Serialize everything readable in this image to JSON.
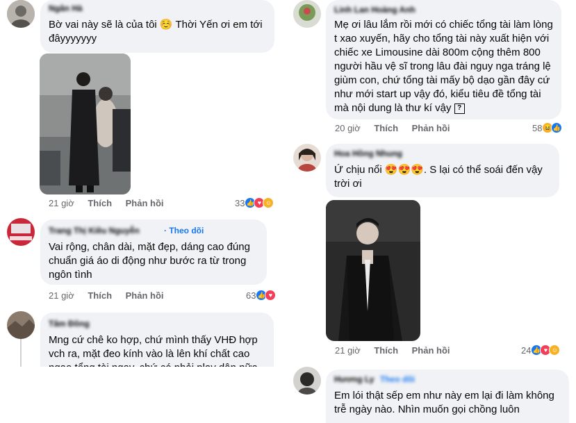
{
  "left": {
    "c1": {
      "name": "Ngân Hà",
      "text": "Bờ vai này sẽ là của tôi ☺️ Thời Yến ơi em tới đâyyyyyyy",
      "time": "21 giờ",
      "like": "Thích",
      "reply": "Phản hồi",
      "count": "33"
    },
    "c2": {
      "name": "Trang Thị Kiều Nguyễn",
      "follow": "· Theo dõi",
      "text": "Vai rộng, chân dài, mặt đẹp, dáng cao đúng chuẩn giá áo di động như bước ra từ trong ngôn tình",
      "time": "21 giờ",
      "like": "Thích",
      "reply": "Phản hồi",
      "count": "63"
    },
    "c3": {
      "name": "Tâm Đông",
      "text": "Mng cứ chê ko hợp, chứ mình thấy VHĐ hợp vch ra, mặt đeo kính vào là lên khí chất cao ngạo tổng tài ngay, chứ có phải play dân nữa"
    }
  },
  "right": {
    "c1": {
      "name": "Linh Lan Hoàng Anh",
      "text": "Mẹ ơi lâu lắm rồi mới có chiếc tổng tài làm lòng t xao xuyến, hãy cho tổng tài này xuất hiện với chiếc xe Limousine dài 800m cộng thêm 800 người hầu vệ sĩ trong lâu đài nguy nga tráng lệ giùm con, chứ tổng tài mấy bộ dạo gần đây cứ như mới start up vậy đó, kiểu tiêu đề tổng tài mà nội dung là thư kí vậy",
      "qmark": "?",
      "time": "20 giờ",
      "like": "Thích",
      "reply": "Phản hồi",
      "count": "58"
    },
    "c2": {
      "name": "Hoa Hồng Nhung",
      "text": "Ứ chịu nổi 😍😍😍. S lại có thể soái đến vậy trời ơi",
      "time": "21 giờ",
      "like": "Thích",
      "reply": "Phản hồi",
      "count": "24"
    },
    "c3": {
      "name": "Hương Ly",
      "follow": "Theo dõi",
      "text": "Em lói thật sếp em như này em lại đi làm không trễ ngày nào. Nhìn muốn gọi chồng luôn"
    }
  },
  "icons": {
    "like": "like-icon",
    "love": "love-icon",
    "haha": "haha-icon",
    "care": "care-icon"
  },
  "colors": {
    "link": "#1877f2",
    "meta": "#65676b",
    "bubble": "#f0f2f5"
  }
}
